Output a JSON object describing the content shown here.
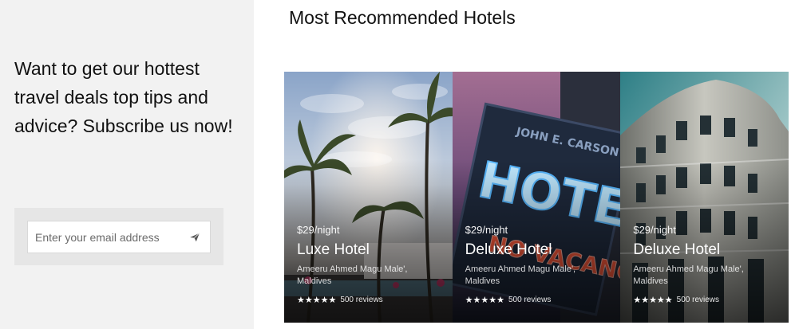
{
  "subscribe": {
    "heading": "Want to get our hottest travel deals top tips and advice? Subscribe us now!",
    "email_placeholder": "Enter your email address",
    "send_icon": "paper-plane-icon"
  },
  "section": {
    "title": "Most Recommended Hotels"
  },
  "hotels": [
    {
      "price": "$29/night",
      "name": "Luxe Hotel",
      "address": "Ameeru Ahmed Magu Male', Maldives",
      "stars": "★★★★★",
      "rating": 4.5,
      "reviews": "500 reviews"
    },
    {
      "price": "$29/night",
      "name": "Deluxe Hotel",
      "address": "Ameeru Ahmed Magu Male', Maldives",
      "stars": "★★★★★",
      "rating": 4.5,
      "reviews": "500 reviews"
    },
    {
      "price": "$29/night",
      "name": "Deluxe Hotel",
      "address": "Ameeru Ahmed Magu Male', Maldives",
      "stars": "★★★★★",
      "rating": 4.5,
      "reviews": "500 reviews"
    }
  ]
}
